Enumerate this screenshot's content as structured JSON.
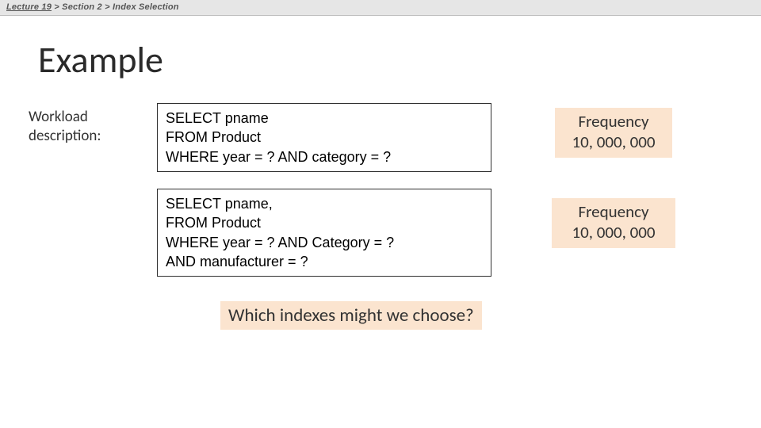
{
  "breadcrumb": {
    "part1": "Lecture 19",
    "sep1": " > ",
    "part2": "Section 2",
    "sep2": " > ",
    "part3": "Index Selection"
  },
  "title": "Example",
  "leftLabel": "Workload description:",
  "queries": [
    {
      "line1": "SELECT pname",
      "line2": "FROM Product",
      "line3": "WHERE year = ? AND category = ?"
    },
    {
      "line1": "SELECT pname,",
      "line2": "FROM Product",
      "line3": "WHERE year = ? AND Category = ?",
      "line4": "AND manufacturer = ?"
    }
  ],
  "frequencies": [
    {
      "label": "Frequency",
      "value": "10, 000, 000"
    },
    {
      "label": "Frequency",
      "value": "10, 000, 000"
    }
  ],
  "question": "Which indexes might we choose?"
}
